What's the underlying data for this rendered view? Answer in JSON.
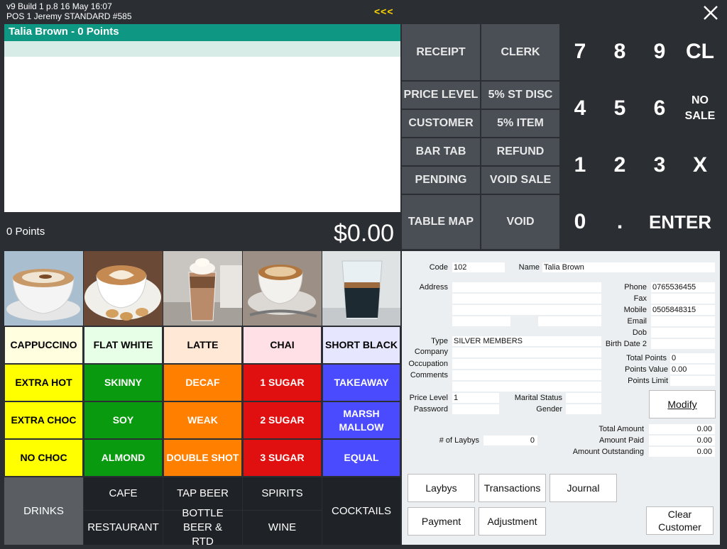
{
  "topbar": {
    "line1": "v9 Build 1 p.8   16 May 16:07",
    "line2": "POS 1  Jeremy  STANDARD   #585",
    "center_arrows": "<<<"
  },
  "sale": {
    "customer_banner": "Talia Brown  -  0 Points",
    "points_label": "0 Points",
    "total": "$0.00"
  },
  "functions": {
    "receipt": "RECEIPT",
    "clerk": "CLERK",
    "price_level": "PRICE LEVEL",
    "st_disc": "5% ST DISC",
    "customer": "CUSTOMER",
    "item_disc": "5% ITEM",
    "bar_tab": "BAR TAB",
    "refund": "REFUND",
    "pending": "PENDING",
    "void_sale": "VOID SALE",
    "table_map": "TABLE MAP",
    "void": "VOID"
  },
  "keypad": {
    "k7": "7",
    "k8": "8",
    "k9": "9",
    "cl": "CL",
    "k4": "4",
    "k5": "5",
    "k6": "6",
    "no_sale_1": "NO",
    "no_sale_2": "SALE",
    "k1": "1",
    "k2": "2",
    "k3": "3",
    "x": "X",
    "k0": "0",
    "dot": ".",
    "enter": "ENTER"
  },
  "products": {
    "row1": [
      "CAPPUCCINO",
      "FLAT WHITE",
      "LATTE",
      "CHAI",
      "SHORT BLACK"
    ],
    "row2": [
      "EXTRA HOT",
      "SKINNY",
      "DECAF",
      "1 SUGAR",
      "TAKEAWAY"
    ],
    "row3": [
      "EXTRA CHOC",
      "SOY",
      "WEAK",
      "2 SUGAR",
      "MARSH MALLOW"
    ],
    "row4": [
      "NO CHOC",
      "ALMOND",
      "DOUBLE SHOT",
      "3 SUGAR",
      "EQUAL"
    ]
  },
  "categories": {
    "drinks": "DRINKS",
    "cafe": "CAFE",
    "tap_beer": "TAP BEER",
    "spirits": "SPIRITS",
    "cocktails": "COCKTAILS",
    "restaurant": "RESTAURANT",
    "bottle_beer": "BOTTLE BEER & RTD",
    "wine": "WINE"
  },
  "form": {
    "code_label": "Code",
    "code_value": "102",
    "name_label": "Name",
    "name_value": "Talia  Brown",
    "address_label": "Address",
    "phone_label": "Phone",
    "phone_value": "0765536455",
    "fax_label": "Fax",
    "fax_value": "",
    "mobile_label": "Mobile",
    "mobile_value": "0505848315",
    "email_label": "Email",
    "email_value": "",
    "dob_label": "Dob",
    "dob_value": "",
    "birth2_label": "Birth Date 2",
    "birth2_value": "",
    "type_label": "Type",
    "type_value": "SILVER MEMBERS",
    "company_label": "Company",
    "occupation_label": "Occupation",
    "comments_label": "Comments",
    "total_points_label": "Total Points",
    "total_points_value": "0",
    "points_value_label": "Points Value",
    "points_value_value": "0.00",
    "points_limit_label": "Points Limit",
    "points_limit_value": "",
    "price_level_label": "Price Level",
    "price_level_value": "1",
    "password_label": "Password",
    "password_value": "",
    "marital_label": "Marital Status",
    "marital_value": "",
    "gender_label": "Gender",
    "gender_value": "",
    "modify_label": "Modify",
    "laybys_count_label": "# of Laybys",
    "laybys_count_value": "0",
    "total_amount_label": "Total Amount",
    "total_amount_value": "0.00",
    "amount_paid_label": "Amount Paid",
    "amount_paid_value": "0.00",
    "amount_outstanding_label": "Amount Outstanding",
    "amount_outstanding_value": "0.00"
  },
  "form_buttons": {
    "laybys": "Laybys",
    "transactions": "Transactions",
    "journal": "Journal",
    "payment": "Payment",
    "adjustment": "Adjustment",
    "clear_customer_1": "Clear",
    "clear_customer_2": "Customer"
  },
  "colors": {
    "banner": "#0e9783",
    "yellow": "#ffff00",
    "green": "#0a9a10",
    "orange": "#ff7f00",
    "red": "#e01010",
    "blue": "#4a4aff"
  }
}
